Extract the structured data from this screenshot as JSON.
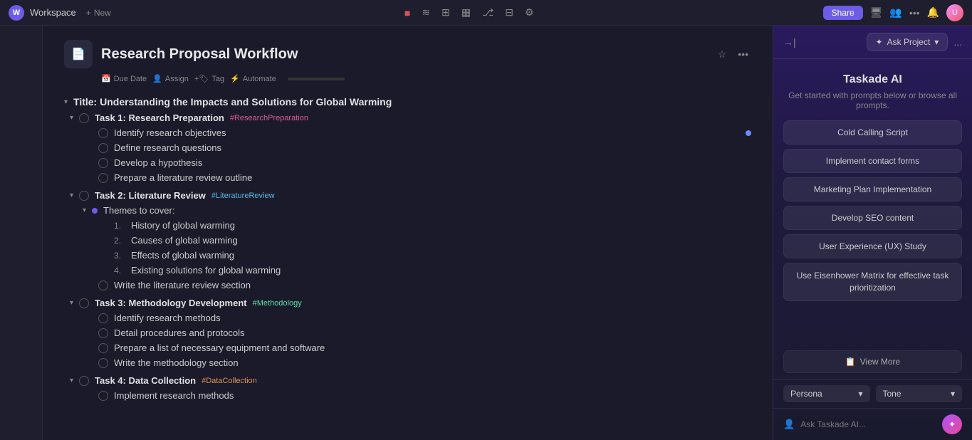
{
  "topbar": {
    "workspace_label": "Workspace",
    "new_label": "New",
    "share_label": "Share",
    "avatar_initials": "U"
  },
  "project": {
    "title": "Research Proposal Workflow",
    "icon": "📄",
    "toolbar_items": [
      {
        "icon": "📅",
        "label": "Due Date"
      },
      {
        "icon": "👤",
        "label": "Assign"
      },
      {
        "icon": "🏷",
        "label": "Tag"
      },
      {
        "icon": "⚡",
        "label": "Automate"
      }
    ]
  },
  "tasks": {
    "section_title": "Title: Understanding the Impacts and Solutions for Global Warming",
    "groups": [
      {
        "id": "task1",
        "label": "Task 1: Research Preparation",
        "tag": "#ResearchPreparation",
        "tag_color": "pink",
        "subtasks": [
          {
            "label": "Identify research objectives",
            "has_dot": true
          },
          {
            "label": "Define research questions"
          },
          {
            "label": "Develop a hypothesis"
          },
          {
            "label": "Prepare a literature review outline"
          }
        ]
      },
      {
        "id": "task2",
        "label": "Task 2: Literature Review",
        "tag": "#LiteratureReview",
        "tag_color": "blue",
        "subtasks": [],
        "bullet_group": {
          "title": "Themes to cover:",
          "items": [
            {
              "num": "1.",
              "label": "History of global warming"
            },
            {
              "num": "2.",
              "label": "Causes of global warming"
            },
            {
              "num": "3.",
              "label": "Effects of global warming"
            },
            {
              "num": "4.",
              "label": "Existing solutions for global warming"
            }
          ]
        },
        "extra": "Write the literature review section"
      },
      {
        "id": "task3",
        "label": "Task 3: Methodology Development",
        "tag": "#Methodology",
        "tag_color": "green",
        "subtasks": [
          {
            "label": "Identify research methods"
          },
          {
            "label": "Detail procedures and protocols"
          },
          {
            "label": "Prepare a list of necessary equipment and software"
          },
          {
            "label": "Write the methodology section"
          }
        ]
      },
      {
        "id": "task4",
        "label": "Task 4: Data Collection",
        "tag": "#DataCollection",
        "tag_color": "orange",
        "subtasks": [
          {
            "label": "Implement research methods"
          }
        ]
      }
    ]
  },
  "sidebar": {
    "collapse_icon": "→|",
    "ask_project_label": "Ask Project",
    "three_dots": "...",
    "ai_title": "Taskade AI",
    "ai_subtitle": "Get started with prompts below or browse all prompts.",
    "prompts": [
      {
        "label": "Cold Calling Script"
      },
      {
        "label": "Implement contact forms"
      },
      {
        "label": "Marketing Plan Implementation"
      },
      {
        "label": "Develop SEO content"
      },
      {
        "label": "User Experience (UX) Study"
      },
      {
        "label": "Use Eisenhower Matrix for effective task prioritization",
        "two_line": true
      }
    ],
    "view_more": "View More",
    "footer": {
      "persona_label": "Persona",
      "tone_label": "Tone"
    },
    "ask_placeholder": "Ask Taskade AI..."
  }
}
